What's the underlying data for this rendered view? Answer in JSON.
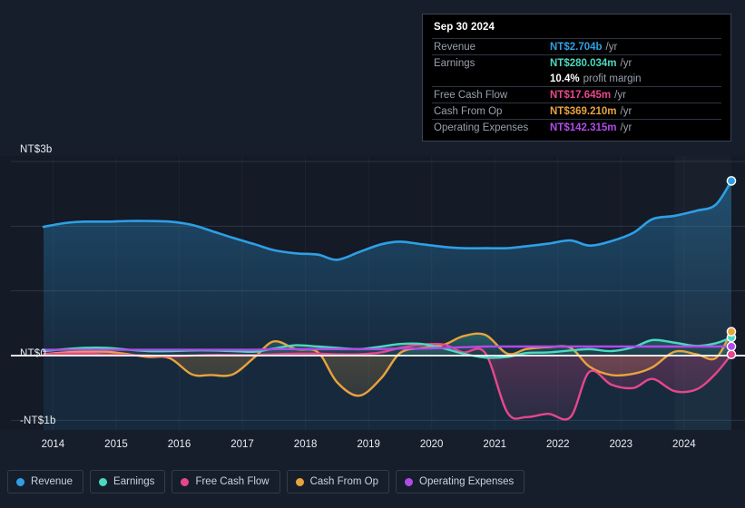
{
  "theme": {
    "background": "#171e2b",
    "plot_background": "#141a26",
    "highlight_band": "#1b2433",
    "zero_line": "#ffffff",
    "gridline": "#2c3443",
    "text": "#e9edf2",
    "muted_text": "#98a0ae"
  },
  "colors": {
    "revenue": "#2e9fe5",
    "earnings": "#4bd8c0",
    "free_cash_flow": "#e8468c",
    "cash_from_op": "#e8a33d",
    "operating_expenses": "#b04be8"
  },
  "tooltip": {
    "date": "Sep 30 2024",
    "rows": [
      {
        "key": "Revenue",
        "value": "NT$2.704b",
        "unit": "/yr",
        "color": "#2e9fe5"
      },
      {
        "key": "Earnings",
        "value": "NT$280.034m",
        "unit": "/yr",
        "color": "#4bd8c0"
      },
      {
        "key": "",
        "value": "10.4%",
        "unit": "profit margin",
        "color": "#ffffff"
      },
      {
        "key": "Free Cash Flow",
        "value": "NT$17.645m",
        "unit": "/yr",
        "color": "#e8468c"
      },
      {
        "key": "Cash From Op",
        "value": "NT$369.210m",
        "unit": "/yr",
        "color": "#e8a33d"
      },
      {
        "key": "Operating Expenses",
        "value": "NT$142.315m",
        "unit": "/yr",
        "color": "#b04be8"
      }
    ]
  },
  "legend": {
    "items": [
      {
        "label": "Revenue",
        "color": "#2e9fe5"
      },
      {
        "label": "Earnings",
        "color": "#4bd8c0"
      },
      {
        "label": "Free Cash Flow",
        "color": "#e8468c"
      },
      {
        "label": "Cash From Op",
        "color": "#e8a33d"
      },
      {
        "label": "Operating Expenses",
        "color": "#b04be8"
      }
    ]
  },
  "axes": {
    "y_top_label": "NT$3b",
    "y_zero_label": "NT$0",
    "y_bottom_label": "-NT$1b",
    "x_labels": [
      "2014",
      "2015",
      "2016",
      "2017",
      "2018",
      "2019",
      "2020",
      "2021",
      "2022",
      "2023",
      "2024"
    ]
  },
  "chart_data": {
    "type": "area",
    "title": "",
    "xlabel": "",
    "ylabel": "NT$",
    "xlim": [
      2013.85,
      2024.85
    ],
    "ylim": [
      -1.0,
      3.0
    ],
    "ytick_values": [
      3,
      2,
      1,
      0,
      -1
    ],
    "ytick_labels": [
      "NT$3b",
      "",
      "",
      "NT$0",
      "-NT$1b"
    ],
    "grid": true,
    "legend_position": "bottom-left",
    "x": [
      2013.85,
      2014.2,
      2014.5,
      2014.85,
      2015.2,
      2015.5,
      2015.85,
      2016.2,
      2016.5,
      2016.85,
      2017.2,
      2017.5,
      2017.85,
      2018.2,
      2018.5,
      2018.85,
      2019.2,
      2019.5,
      2019.85,
      2020.2,
      2020.5,
      2020.85,
      2021.2,
      2021.5,
      2021.85,
      2022.2,
      2022.5,
      2022.85,
      2023.2,
      2023.5,
      2023.85,
      2024.2,
      2024.5,
      2024.75
    ],
    "series": [
      {
        "name": "Revenue",
        "color": "#2e9fe5",
        "values": [
          1.99,
          2.05,
          2.07,
          2.07,
          2.08,
          2.08,
          2.07,
          2.02,
          1.93,
          1.82,
          1.72,
          1.63,
          1.58,
          1.56,
          1.48,
          1.6,
          1.72,
          1.76,
          1.72,
          1.68,
          1.66,
          1.66,
          1.66,
          1.69,
          1.73,
          1.78,
          1.7,
          1.77,
          1.9,
          2.11,
          2.16,
          2.24,
          2.33,
          2.7
        ]
      },
      {
        "name": "Earnings",
        "color": "#4bd8c0",
        "values": [
          0.07,
          0.1,
          0.12,
          0.12,
          0.09,
          0.07,
          0.07,
          0.08,
          0.08,
          0.07,
          0.06,
          0.11,
          0.16,
          0.14,
          0.12,
          0.1,
          0.14,
          0.18,
          0.18,
          0.11,
          0.03,
          -0.03,
          -0.02,
          0.04,
          0.05,
          0.08,
          0.1,
          0.07,
          0.13,
          0.24,
          0.2,
          0.15,
          0.19,
          0.28
        ]
      },
      {
        "name": "Free Cash Flow",
        "color": "#e8468c",
        "values": [
          0.02,
          0.03,
          0.03,
          0.02,
          0.01,
          0.0,
          -0.01,
          0.0,
          0.01,
          0.01,
          0.01,
          0.02,
          0.03,
          0.03,
          0.02,
          0.02,
          0.05,
          0.12,
          0.17,
          0.17,
          0.05,
          0.04,
          -0.88,
          -0.95,
          -0.9,
          -0.95,
          -0.25,
          -0.45,
          -0.5,
          -0.36,
          -0.55,
          -0.52,
          -0.28,
          0.018
        ]
      },
      {
        "name": "Cash From Op",
        "color": "#e8a33d",
        "values": [
          0.02,
          0.05,
          0.06,
          0.06,
          0.02,
          -0.02,
          -0.04,
          -0.29,
          -0.3,
          -0.29,
          -0.02,
          0.22,
          0.1,
          0.05,
          -0.41,
          -0.62,
          -0.35,
          0.04,
          0.12,
          0.17,
          0.3,
          0.32,
          0.03,
          0.1,
          0.13,
          0.12,
          -0.17,
          -0.3,
          -0.28,
          -0.18,
          0.06,
          0.02,
          -0.04,
          0.369
        ]
      },
      {
        "name": "Operating Expenses",
        "color": "#b04be8",
        "values": [
          0.09,
          0.09,
          0.09,
          0.09,
          0.09,
          0.09,
          0.09,
          0.09,
          0.09,
          0.09,
          0.09,
          0.1,
          0.1,
          0.1,
          0.1,
          0.1,
          0.1,
          0.11,
          0.11,
          0.12,
          0.13,
          0.14,
          0.14,
          0.14,
          0.14,
          0.14,
          0.14,
          0.14,
          0.14,
          0.14,
          0.14,
          0.14,
          0.14,
          0.142
        ]
      }
    ],
    "annotations": {
      "highlight_band_start": 2023.85,
      "highlight_band_end": 2024.85,
      "end_marker_date": "Sep 30 2024"
    }
  }
}
